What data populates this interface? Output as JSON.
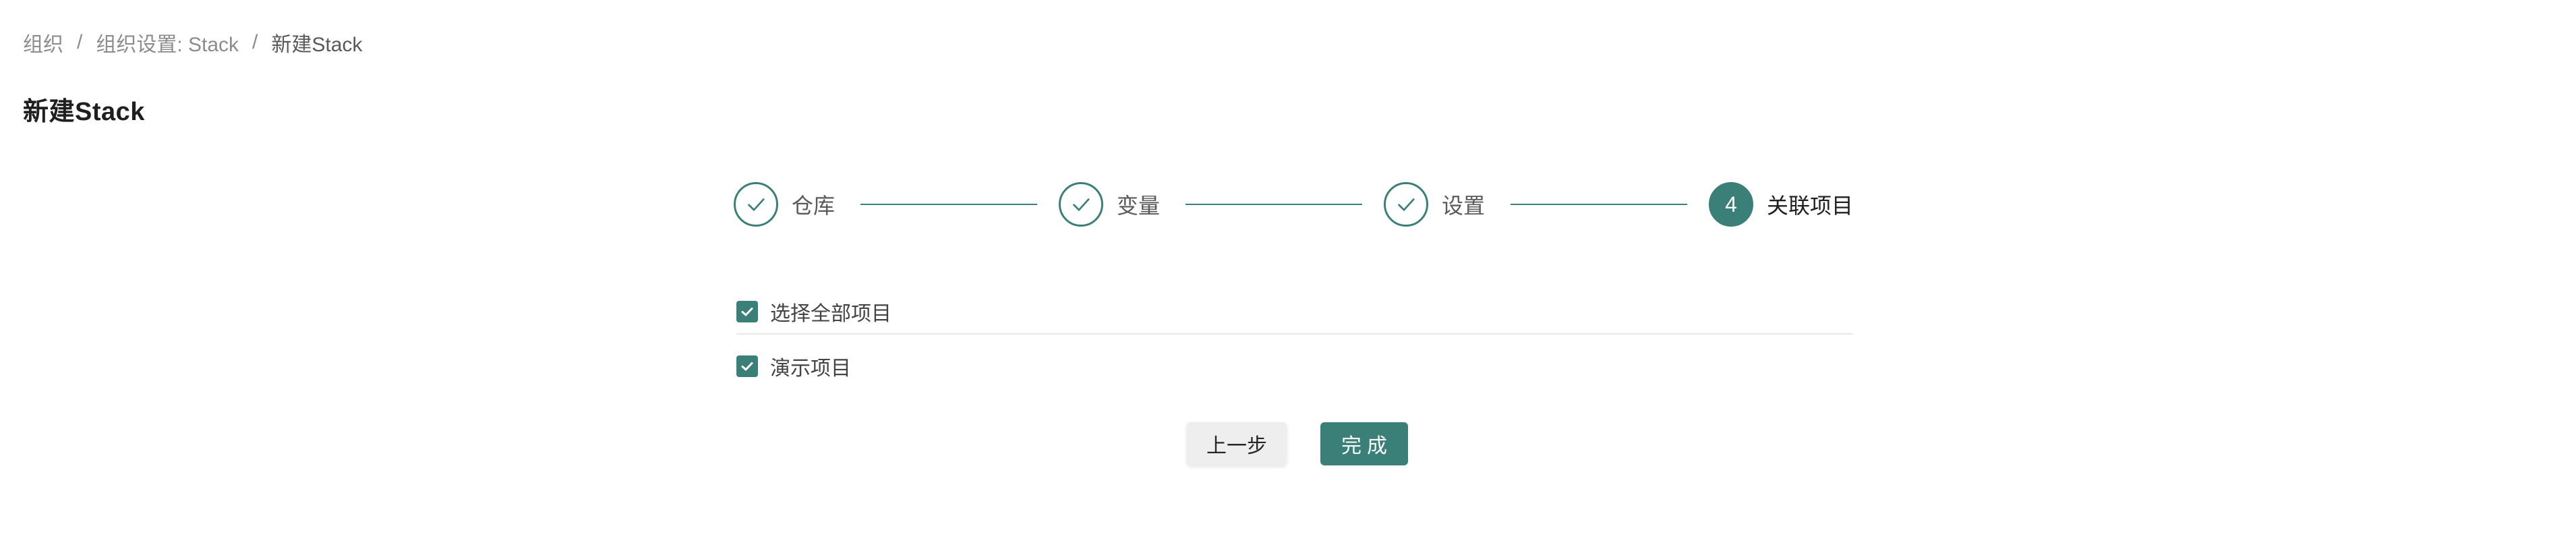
{
  "breadcrumb": {
    "items": [
      "组织",
      "组织设置: Stack",
      "新建Stack"
    ],
    "separator": "/"
  },
  "page": {
    "title": "新建Stack"
  },
  "steps": [
    {
      "label": "仓库",
      "status": "done"
    },
    {
      "label": "变量",
      "status": "done"
    },
    {
      "label": "设置",
      "status": "done"
    },
    {
      "label": "关联项目",
      "status": "active",
      "number": "4"
    }
  ],
  "projects": {
    "select_all_label": "选择全部项目",
    "select_all_checked": true,
    "items": [
      {
        "label": "演示项目",
        "checked": true
      }
    ]
  },
  "actions": {
    "prev_label": "上一步",
    "done_label": "完成"
  },
  "colors": {
    "primary": "#3b8078",
    "text": "#262626",
    "muted": "#8c8c8c",
    "divider": "#e8e8e8",
    "secondary_button_bg": "#eeeeee"
  },
  "icons": {
    "step_done": "check-icon",
    "checkbox_checked": "checkbox-checked-icon"
  }
}
